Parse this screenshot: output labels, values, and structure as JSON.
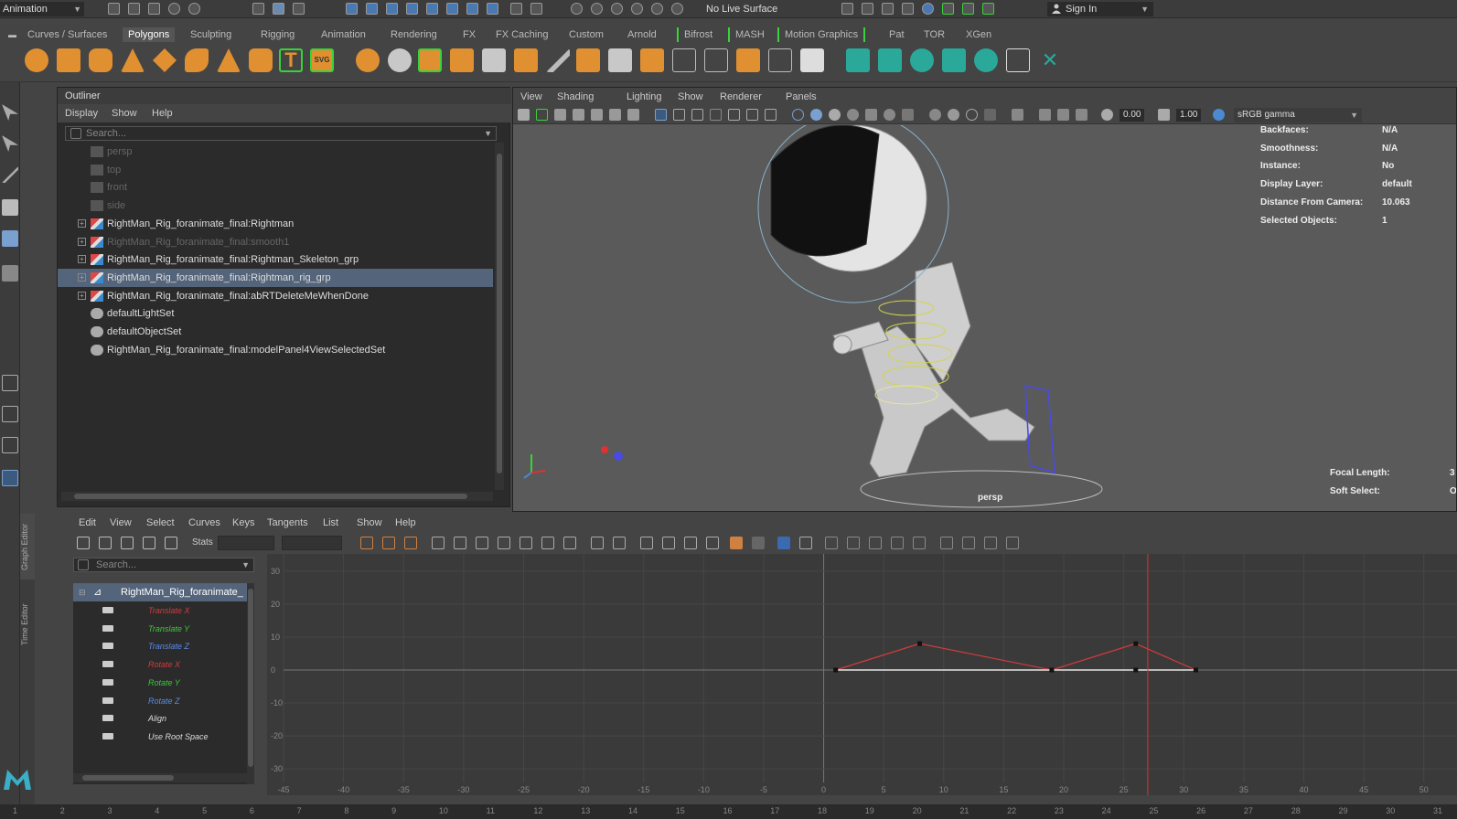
{
  "topbar": {
    "mode": "Animation",
    "live_surface": "No Live Surface",
    "signin": "Sign In"
  },
  "shelf_tabs": [
    "Curves / Surfaces",
    "Polygons",
    "Sculpting",
    "Rigging",
    "Animation",
    "Rendering",
    "FX",
    "FX Caching",
    "Custom",
    "Arnold",
    "Bifrost",
    "MASH",
    "Motion Graphics",
    "Pat",
    "TOR",
    "XGen"
  ],
  "shelf_active": "Polygons",
  "outliner": {
    "title": "Outliner",
    "menu": [
      "Display",
      "Show",
      "Help"
    ],
    "search_placeholder": "Search...",
    "rows": [
      {
        "label": "persp",
        "type": "camera",
        "dim": true
      },
      {
        "label": "top",
        "type": "camera",
        "dim": true
      },
      {
        "label": "front",
        "type": "camera",
        "dim": true
      },
      {
        "label": "side",
        "type": "camera",
        "dim": true
      },
      {
        "label": "RightMan_Rig_foranimate_final:Rightman",
        "type": "transform",
        "dim": false,
        "expand": true
      },
      {
        "label": "RightMan_Rig_foranimate_final:smooth1",
        "type": "transform",
        "dim": true,
        "expand": true
      },
      {
        "label": "RightMan_Rig_foranimate_final:Rightman_Skeleton_grp",
        "type": "transform",
        "dim": false,
        "expand": true
      },
      {
        "label": "RightMan_Rig_foranimate_final:Rightman_rig_grp",
        "type": "transform",
        "dim": false,
        "expand": true,
        "selected": true
      },
      {
        "label": "RightMan_Rig_foranimate_final:abRTDeleteMeWhenDone",
        "type": "transform",
        "dim": false,
        "expand": true
      },
      {
        "label": "defaultLightSet",
        "type": "set",
        "dim": false
      },
      {
        "label": "defaultObjectSet",
        "type": "set",
        "dim": false
      },
      {
        "label": "RightMan_Rig_foranimate_final:modelPanel4ViewSelectedSet",
        "type": "set",
        "dim": false
      }
    ]
  },
  "viewport": {
    "menu": [
      "View",
      "Shading",
      "Lighting",
      "Show",
      "Renderer",
      "Panels"
    ],
    "field_a": "0.00",
    "field_b": "1.00",
    "color_management": "sRGB gamma",
    "camera": "persp",
    "hud_top": [
      {
        "label": "Backfaces:",
        "value": "N/A"
      },
      {
        "label": "Smoothness:",
        "value": "N/A"
      },
      {
        "label": "Instance:",
        "value": "No"
      },
      {
        "label": "Display Layer:",
        "value": "default"
      },
      {
        "label": "Distance From Camera:",
        "value": "10.063"
      },
      {
        "label": "Selected Objects:",
        "value": "1"
      }
    ],
    "hud_bottom": [
      {
        "label": "Focal Length:",
        "value": "3"
      },
      {
        "label": "Soft Select:",
        "value": "O"
      }
    ]
  },
  "graph_editor": {
    "side_tabs": [
      "Graph Editor",
      "Time Editor"
    ],
    "menu": [
      "Edit",
      "View",
      "Select",
      "Curves",
      "Keys",
      "Tangents",
      "List",
      "Show",
      "Help"
    ],
    "stats_label": "Stats",
    "search_placeholder": "Search...",
    "node": "RightMan_Rig_foranimate_",
    "channels": [
      {
        "label": "Translate X",
        "color": "#d23c3c"
      },
      {
        "label": "Translate Y",
        "color": "#3cc83c"
      },
      {
        "label": "Translate Z",
        "color": "#5a8ce6"
      },
      {
        "label": "Rotate X",
        "color": "#d23c3c"
      },
      {
        "label": "Rotate Y",
        "color": "#3cc83c"
      },
      {
        "label": "Rotate Z",
        "color": "#5a8ce6"
      },
      {
        "label": "Align",
        "color": "#dddddd"
      },
      {
        "label": "Use Root Space",
        "color": "#dddddd"
      }
    ],
    "y_ticks": [
      "30",
      "20",
      "10",
      "0",
      "-10",
      "-20",
      "-30"
    ],
    "x_ticks": [
      "-45",
      "-40",
      "-35",
      "-30",
      "-25",
      "-20",
      "-15",
      "-10",
      "-5",
      "0",
      "5",
      "10",
      "15",
      "20",
      "25",
      "30",
      "35",
      "40",
      "45",
      "50"
    ],
    "current_time": 27
  },
  "chart_data": {
    "type": "line",
    "xlabel": "",
    "ylabel": "",
    "xlim": [
      -45,
      52
    ],
    "ylim": [
      -33,
      33
    ],
    "grid": true,
    "series": [
      {
        "color": "#d23c3c",
        "points": [
          [
            1,
            0
          ],
          [
            8,
            8
          ],
          [
            19,
            0
          ],
          [
            26,
            8
          ],
          [
            31,
            0
          ]
        ]
      },
      {
        "color": "#bbbbbb",
        "points": [
          [
            1,
            0
          ],
          [
            19,
            0
          ],
          [
            26,
            0
          ],
          [
            31,
            0
          ]
        ]
      }
    ]
  },
  "timeslider": {
    "ticks": [
      "1",
      "2",
      "3",
      "4",
      "5",
      "6",
      "7",
      "8",
      "9",
      "10",
      "11",
      "12",
      "13",
      "14",
      "15",
      "16",
      "17",
      "18",
      "19",
      "20",
      "21",
      "22",
      "23",
      "24",
      "25",
      "26",
      "27",
      "28",
      "29",
      "30",
      "31"
    ]
  },
  "colors": {
    "accent": "#54647a",
    "selection": "#54647a",
    "time_marker": "#e03030"
  }
}
